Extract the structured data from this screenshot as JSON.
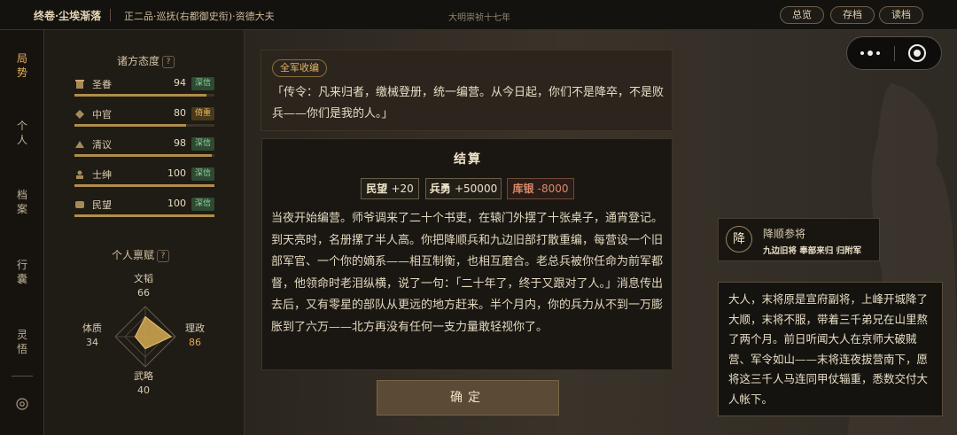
{
  "topbar": {
    "title": "终卷·尘埃渐落",
    "rank": "正二品·巡抚(右都御史衔)·资德大夫",
    "era": "大明崇祯十七年",
    "buttons": [
      "总览",
      "存档",
      "读档"
    ]
  },
  "rail": {
    "items": [
      {
        "label": "局\n势",
        "active": true
      },
      {
        "label": "个\n人",
        "active": false
      },
      {
        "label": "档\n案",
        "active": false
      },
      {
        "label": "行\n囊",
        "active": false
      },
      {
        "label": "灵\n悟",
        "active": false
      }
    ],
    "settings_icon": "settings-icon"
  },
  "attitudes": {
    "title": "诸方态度",
    "help": "?",
    "items": [
      {
        "name": "圣眷",
        "value": 94,
        "badge": "深信",
        "badge_color": "#4f9a5e",
        "icon": "scroll-icon"
      },
      {
        "name": "中官",
        "value": 80,
        "badge": "倚重",
        "badge_color": "#b8892f",
        "icon": "eunuch-icon"
      },
      {
        "name": "清议",
        "value": 98,
        "badge": "深信",
        "badge_color": "#4f9a5e",
        "icon": "scholar-icon"
      },
      {
        "name": "士绅",
        "value": 100,
        "badge": "深信",
        "badge_color": "#4f9a5e",
        "icon": "gentry-icon"
      },
      {
        "name": "民望",
        "value": 100,
        "badge": "深信",
        "badge_color": "#4f9a5e",
        "icon": "people-icon"
      }
    ]
  },
  "traits": {
    "title": "个人禀赋",
    "help": "?",
    "stats": [
      {
        "name": "文韬",
        "value": 66,
        "highlight": false
      },
      {
        "name": "理政",
        "value": 86,
        "highlight": true
      },
      {
        "name": "武略",
        "value": 40,
        "highlight": false
      },
      {
        "name": "体质",
        "value": 34,
        "highlight": false
      }
    ]
  },
  "orders": {
    "tag": "全军收编",
    "text": "「传令：凡来归者，缴械登册，统一编营。从今日起，你们不是降卒，不是败兵——你们是我的人。」"
  },
  "settlement": {
    "title": "结算",
    "deltas": [
      {
        "label": "民望",
        "value": "+20",
        "negative": false
      },
      {
        "label": "兵勇",
        "value": "+50000",
        "negative": false
      },
      {
        "label": "库银",
        "value": "-8000",
        "negative": true
      }
    ],
    "text": "当夜开始编营。师爷调来了二十个书吏，在辕门外摆了十张桌子，通宵登记。到天亮时，名册摞了半人高。你把降顺兵和九边旧部打散重编，每营设一个旧部军官、一个你的嫡系——相互制衡，也相互磨合。老总兵被你任命为前军都督，他领命时老泪纵横，说了一句：「二十年了，终于又跟对了人。」消息传出去后，又有零星的部队从更远的地方赶来。半个月内，你的兵力从不到一万膨胀到了六万——北方再没有任何一支力量敢轻视你了。",
    "confirm": "确定"
  },
  "npc": {
    "seal": "降",
    "name": "降顺参将",
    "tags": "九边旧将 奉部来归 归附军",
    "speech": "大人，末将原是宣府副将，上峰开城降了大顺，末将不服，带着三千弟兄在山里熬了两个月。前日听闻大人在京师大破贼营、军令如山——末将连夜拔营南下，愿将这三千人马连同甲仗辎重，悉数交付大人帐下。"
  },
  "colors": {
    "accent": "#e8b25c",
    "trust_green": "#4f9a5e",
    "reliance_gold": "#b8892f",
    "negative": "#d98a6a"
  }
}
